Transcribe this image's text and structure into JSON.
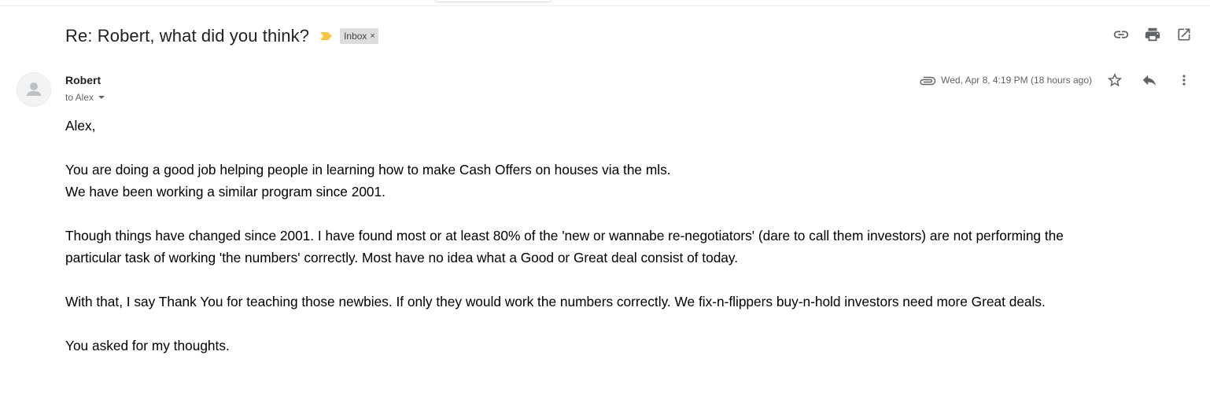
{
  "email": {
    "subject": "Re: Robert, what did you think?",
    "label": "Inbox",
    "label_close": "×",
    "sender": "Robert",
    "recipient": "to Alex",
    "date": "Wed, Apr 8, 4:19 PM (18 hours ago)",
    "body": {
      "greeting": "Alex,",
      "p1_line1": "You are doing a good job helping people in learning how to make Cash Offers on houses via the mls.",
      "p1_line2": "We have been working a similar program since 2001.",
      "p2_line1": "Though things have changed since 2001. I have found most or at least 80% of the 'new or wannabe re-negotiators' (dare to call them investors) are not performing the",
      "p2_line2": "particular task of working 'the numbers' correctly. Most have no idea what a Good or Great deal consist of today.",
      "p3": "With that, I say Thank You for teaching those newbies. If only they would work the numbers correctly. We fix-n-flippers buy-n-hold investors need more Great deals.",
      "p4": "You asked for my thoughts."
    }
  },
  "icons": {
    "importance": "importance-marker-icon",
    "link": "link-icon",
    "print": "print-icon",
    "open_new": "open-in-new-window-icon",
    "attachment": "attachment-icon",
    "star": "star-icon",
    "reply": "reply-icon",
    "more": "more-vertical-icon",
    "avatar": "default-avatar-icon"
  },
  "colors": {
    "importance": "#f6c543",
    "label_bg": "#dddddd",
    "icon": "#5f6368"
  }
}
